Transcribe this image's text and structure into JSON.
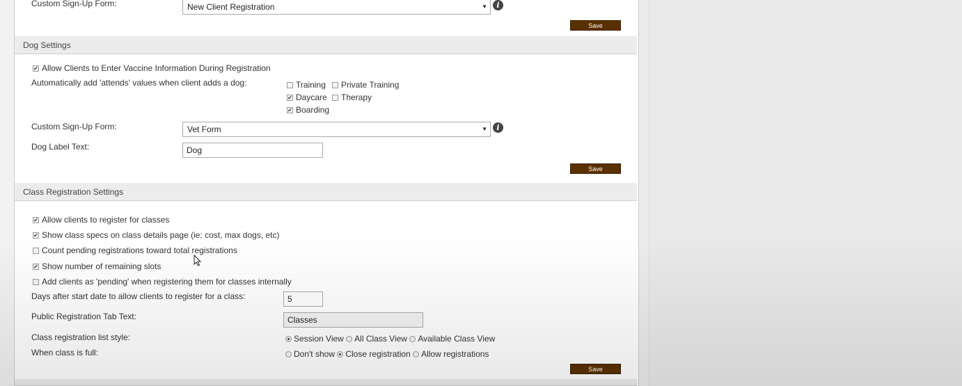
{
  "client_section": {
    "signup_label": "Custom Sign-Up Form:",
    "signup_value": "New Client Registration",
    "save_label": "Save"
  },
  "dog_section": {
    "header": "Dog Settings",
    "vaccine_label": "Allow Clients to Enter Vaccine Information During Registration",
    "vaccine_checked": true,
    "attends_label": "Automatically add 'attends' values when client adds a dog:",
    "attends_options": [
      {
        "label": "Training",
        "checked": false
      },
      {
        "label": "Private Training",
        "checked": false
      },
      {
        "label": "Daycare",
        "checked": true
      },
      {
        "label": "Therapy",
        "checked": false
      },
      {
        "label": "Boarding",
        "checked": true
      }
    ],
    "signup_label": "Custom Sign-Up Form:",
    "signup_value": "Vet Form",
    "dog_label_text_label": "Dog Label Text:",
    "dog_label_text_value": "Dog",
    "save_label": "Save"
  },
  "class_section": {
    "header": "Class Registration Settings",
    "checkboxes": [
      {
        "label": "Allow clients to register for classes",
        "checked": true
      },
      {
        "label": "Show class specs on class details page (ie: cost, max dogs, etc)",
        "checked": true
      },
      {
        "label": "Count pending registrations toward total registrations",
        "checked": false
      },
      {
        "label": "Show number of remaining slots",
        "checked": true
      },
      {
        "label": "Add clients as 'pending' when registering them for classes internally",
        "checked": false
      }
    ],
    "days_label": "Days after start date to allow clients to register for a class:",
    "days_value": "5",
    "tab_text_label": "Public Registration Tab Text:",
    "tab_text_value": "Classes",
    "list_style_label": "Class registration list style:",
    "list_style_options": [
      {
        "label": "Session View",
        "selected": true
      },
      {
        "label": "All Class View",
        "selected": false
      },
      {
        "label": "Available Class View",
        "selected": false
      }
    ],
    "full_label": "When class is full:",
    "full_options": [
      {
        "label": "Don't show",
        "selected": false
      },
      {
        "label": "Close registration",
        "selected": true
      },
      {
        "label": "Allow registrations",
        "selected": false
      }
    ],
    "save_label": "Save"
  },
  "icons": {
    "info": "info-circle-icon",
    "check": "check-icon",
    "cursor": "mouse-cursor-icon"
  }
}
